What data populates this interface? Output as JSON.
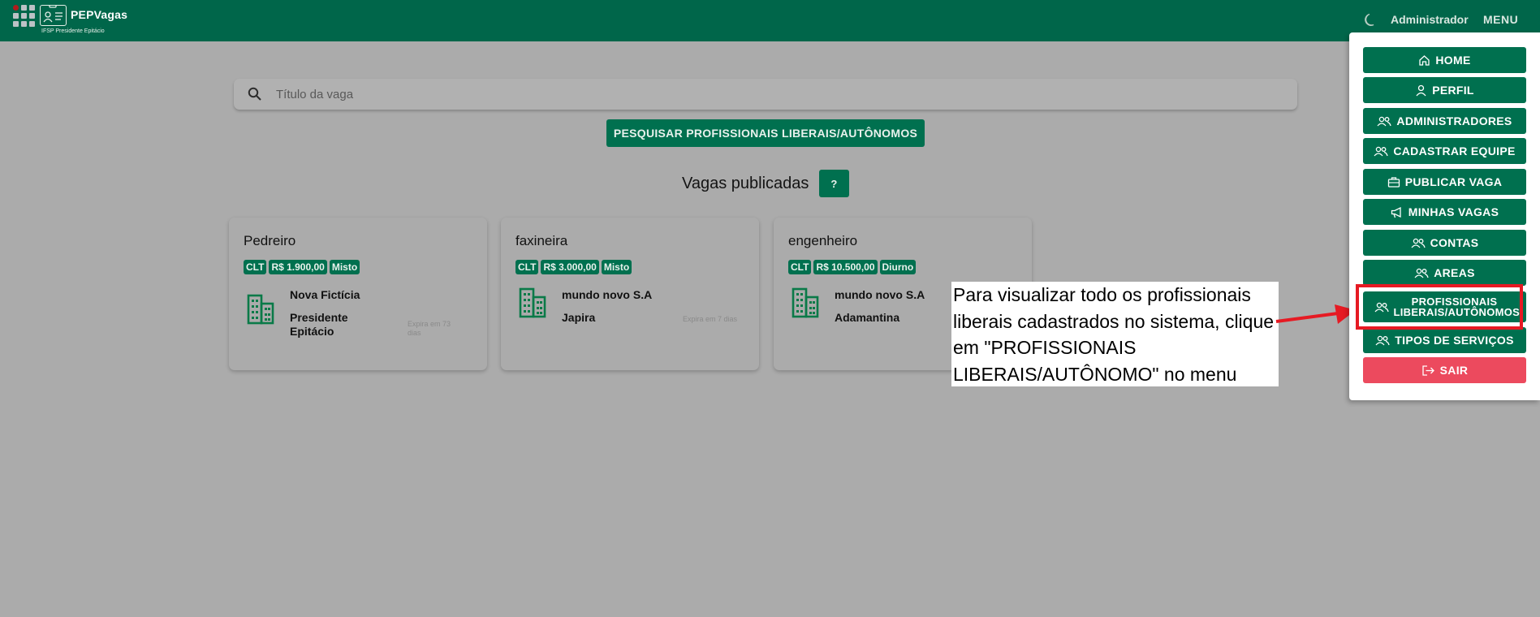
{
  "header": {
    "brand": "PEPVagas",
    "subtitle": "IFSP Presidente Epitácio",
    "user": "Administrador",
    "menu_label": "MENU"
  },
  "search": {
    "placeholder": "Título da vaga",
    "button_label": "PESQUISAR PROFISSIONAIS LIBERAIS/AUTÔNOMOS"
  },
  "section": {
    "title": "Vagas publicadas",
    "help_label": "?"
  },
  "jobs": [
    {
      "title": "Pedreiro",
      "contract": "CLT",
      "salary": "R$ 1.900,00",
      "shift": "Misto",
      "company": "Nova Fictícia",
      "city": "Presidente Epitácio",
      "expires": "Expira em 73 dias"
    },
    {
      "title": "faxineira",
      "contract": "CLT",
      "salary": "R$ 3.000,00",
      "shift": "Misto",
      "company": "mundo novo S.A",
      "city": "Japira",
      "expires": "Expira em 7 dias"
    },
    {
      "title": "engenheiro",
      "contract": "CLT",
      "salary": "R$ 10.500,00",
      "shift": "Diurno",
      "company": "mundo novo S.A",
      "city": "Adamantina",
      "expires": ""
    }
  ],
  "menu": {
    "items": [
      {
        "label": "HOME",
        "icon": "home-icon"
      },
      {
        "label": "PERFIL",
        "icon": "user-icon"
      },
      {
        "label": "ADMINISTRADORES",
        "icon": "users-icon"
      },
      {
        "label": "CADASTRAR EQUIPE",
        "icon": "users-icon"
      },
      {
        "label": "PUBLICAR VAGA",
        "icon": "briefcase-icon"
      },
      {
        "label": "MINHAS VAGAS",
        "icon": "megaphone-icon"
      },
      {
        "label": "CONTAS",
        "icon": "users-icon"
      },
      {
        "label": "AREAS",
        "icon": "users-icon"
      },
      {
        "label": "PROFISSIONAIS LIBERAIS/AUTÔNOMOS",
        "icon": "users-icon"
      },
      {
        "label": "TIPOS DE SERVIÇOS",
        "icon": "users-icon"
      },
      {
        "label": "SAIR",
        "icon": "logout-icon"
      }
    ]
  },
  "annotation": {
    "text": "Para visualizar todo os profissionais liberais cadastrados no sistema, clique em \"PROFISSIONAIS LIBERAIS/AUTÔNOMO\" no menu"
  },
  "colors": {
    "primary": "#00704f",
    "topbar": "#00664a",
    "logout": "#ec4a5e",
    "annotation_highlight": "#e61a23"
  }
}
